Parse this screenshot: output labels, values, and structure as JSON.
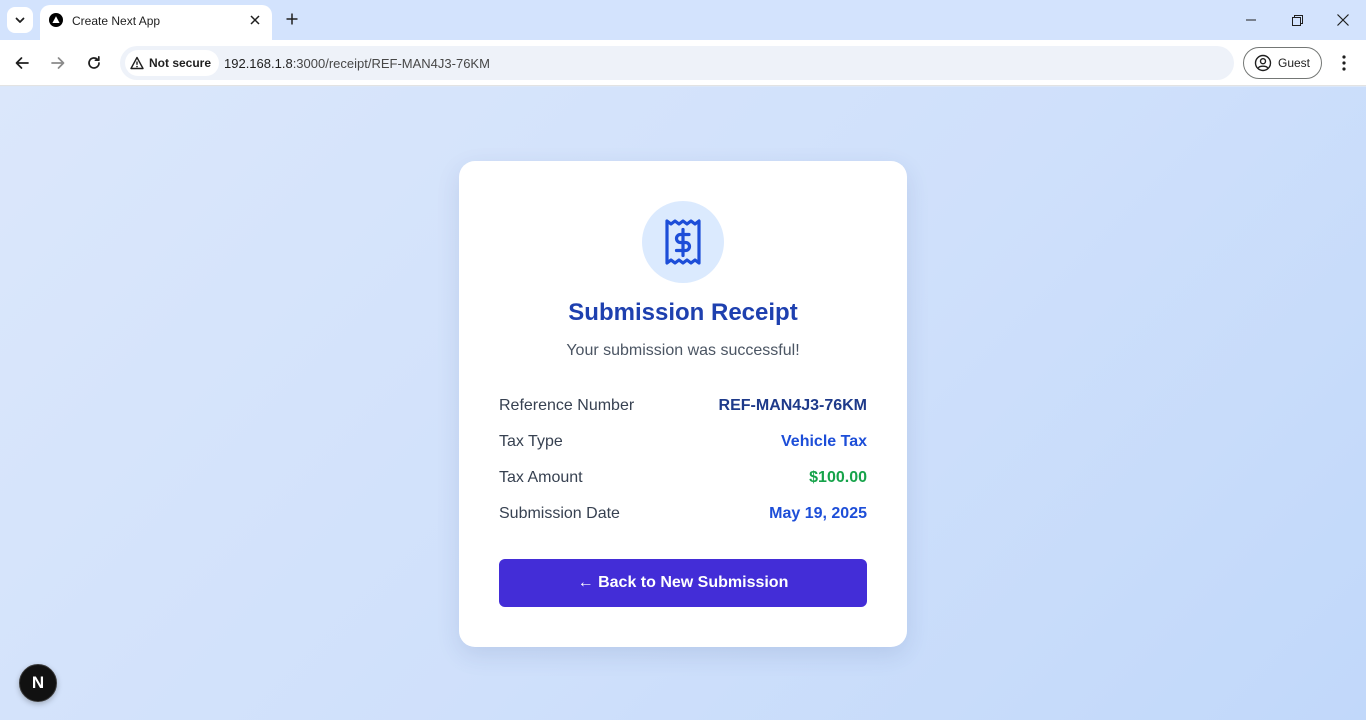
{
  "browser": {
    "tab": {
      "title": "Create Next App"
    },
    "address_bar": {
      "security_label": "Not secure",
      "url_host": "192.168.1.8",
      "url_rest": ":3000/receipt/REF-MAN4J3-76KM"
    },
    "profile": {
      "label": "Guest"
    }
  },
  "receipt": {
    "icon": "receipt-dollar-icon",
    "title": "Submission Receipt",
    "subtitle": "Your submission was successful!",
    "rows": [
      {
        "label": "Reference Number",
        "value": "REF-MAN4J3-76KM",
        "color": "#1e3a8a"
      },
      {
        "label": "Tax Type",
        "value": "Vehicle Tax",
        "color": "#1d4ed8"
      },
      {
        "label": "Tax Amount",
        "value": "$100.00",
        "color": "#16a34a"
      },
      {
        "label": "Submission Date",
        "value": "May 19, 2025",
        "color": "#1d4ed8"
      }
    ],
    "back_button_label": "← Back to New Submission"
  },
  "dev_badge": {
    "label": "N"
  },
  "colors": {
    "title": "#1e40af",
    "button": "#432dd7",
    "icon_circle": "#dbeafe",
    "icon": "#1d4ed8"
  }
}
